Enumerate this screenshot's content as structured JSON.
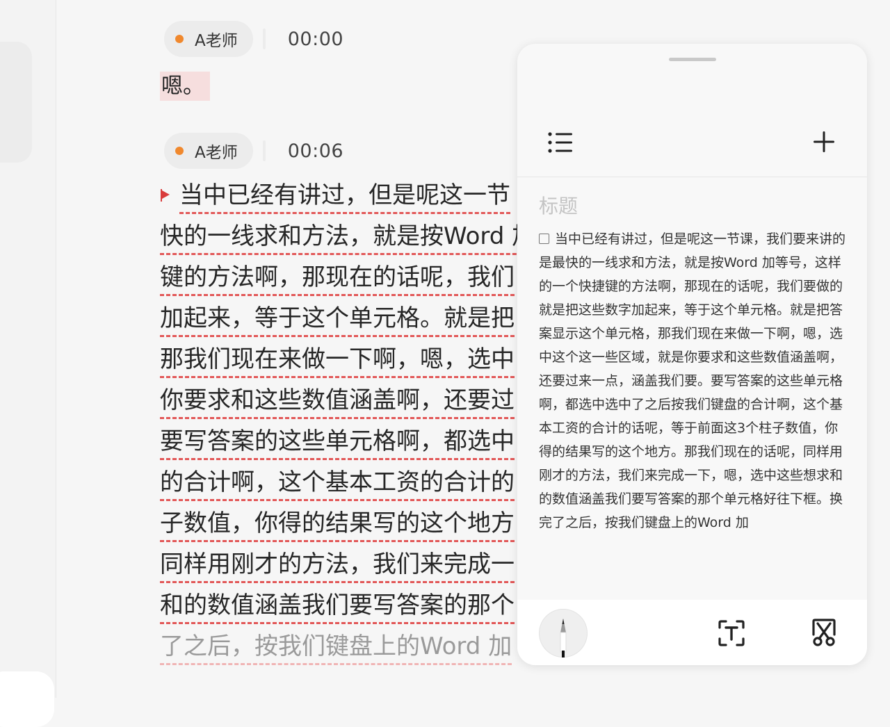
{
  "transcript": {
    "segments": [
      {
        "speaker": "A老师",
        "time": "00:00",
        "lines": [
          "嗯。"
        ]
      },
      {
        "speaker": "A老师",
        "time": "00:06",
        "lines": [
          "当中已经有讲过，但是呢这一节",
          "快的一线求和方法，就是按Word 加",
          "键的方法啊，那现在的话呢，我们",
          "加起来，等于这个单元格。就是把",
          "那我们现在来做一下啊，嗯，选中",
          "你要求和这些数值涵盖啊，还要过",
          "要写答案的这些单元格啊，都选中",
          "的合计啊，这个基本工资的合计的",
          "子数值，你得的结果写的这个地方",
          "同样用刚才的方法，我们来完成一",
          "和的数值涵盖我们要写答案的那个",
          "了之后，按我们键盘上的Word 加"
        ]
      }
    ]
  },
  "note_panel": {
    "title_placeholder": "标题",
    "body": "当中已经有讲过，但是呢这一节课，我们要来讲的是最快的一线求和方法，就是按Word 加等号，这样的一个快捷键的方法啊，那现在的话呢，我们要做的就是把这些数字加起来，等于这个单元格。就是把答案显示这个单元格，那我们现在来做一下啊，嗯，选中这个这一些区域，就是你要求和这些数值涵盖啊，还要过来一点，涵盖我们要。要写答案的这些单元格啊，都选中选中了之后按我们键盘的合计啊，这个基本工资的合计的话呢，等于前面这3个柱子数值，你得的结果写的这个地方。那我们现在的话呢，同样用刚才的方法，我们来完成一下，嗯，选中这些想求和的数值涵盖我们要写答案的那个单元格好往下框。换完了之后，按我们键盘上的Word 加",
    "icons": {
      "list": "list-icon",
      "add": "plus-icon",
      "pen": "pen-icon",
      "ocr": "text-recognition-icon",
      "screenshot": "screenshot-cut-icon"
    }
  },
  "colors": {
    "speaker_dot": "#f0882d",
    "underline": "#e25757",
    "highlight": "#f6dede"
  }
}
